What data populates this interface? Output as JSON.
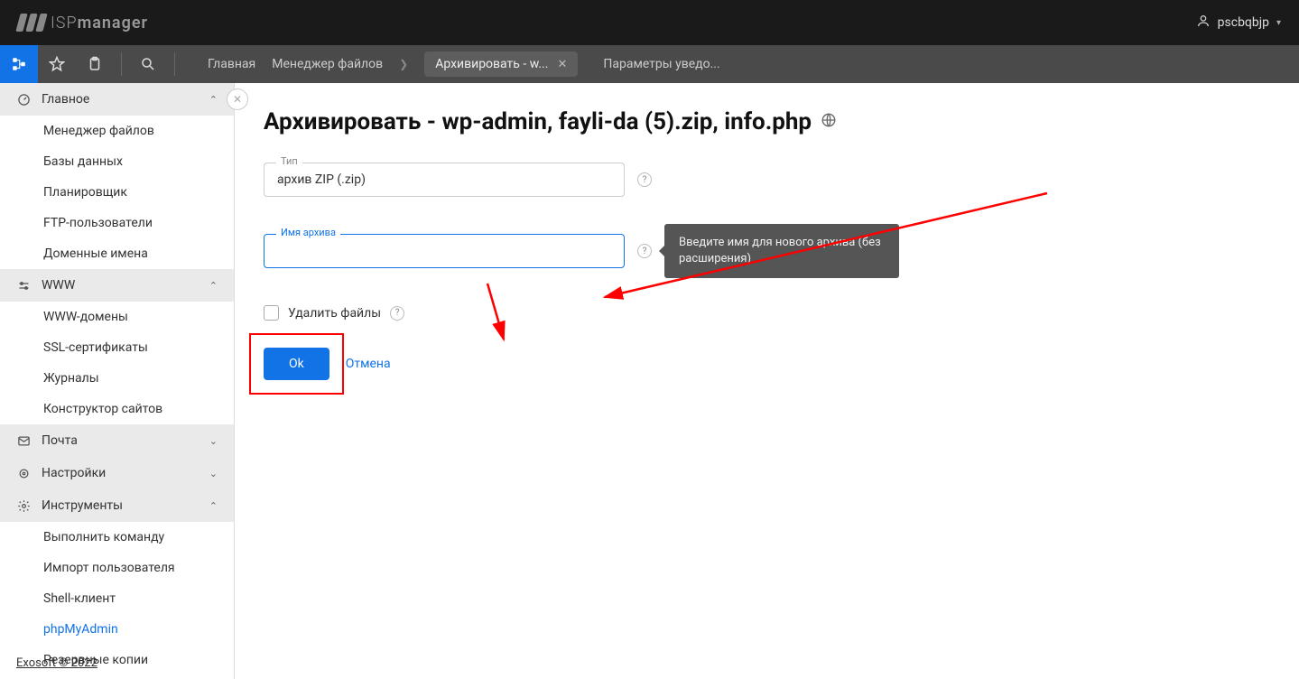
{
  "header": {
    "logo_text": "ISP",
    "logo_text2": "manager",
    "user": "pscbqbjp"
  },
  "subheader": {
    "breadcrumb_home": "Главная",
    "breadcrumb_fm": "Менеджер файлов",
    "tab_label": "Архивировать - w...",
    "extra": "Параметры уведо..."
  },
  "sidebar": {
    "groups": [
      {
        "label": "Главное",
        "expanded": true,
        "icon": "gauge",
        "items": [
          "Менеджер файлов",
          "Базы данных",
          "Планировщик",
          "FTP-пользователи",
          "Доменные имена"
        ]
      },
      {
        "label": "WWW",
        "expanded": true,
        "icon": "sliders",
        "items": [
          "WWW-домены",
          "SSL-сертификаты",
          "Журналы",
          "Конструктор сайтов"
        ]
      },
      {
        "label": "Почта",
        "expanded": false,
        "icon": "mail",
        "items": []
      },
      {
        "label": "Настройки",
        "expanded": false,
        "icon": "cog",
        "items": []
      },
      {
        "label": "Инструменты",
        "expanded": true,
        "icon": "gear",
        "items": [
          "Выполнить команду",
          "Импорт пользователя",
          "Shell-клиент",
          "phpMyAdmin",
          "Резервные копии"
        ]
      }
    ],
    "active_item": "phpMyAdmin"
  },
  "page": {
    "title": "Архивировать - wp-admin, fayli-da (5).zip, info.php",
    "type_label": "Тип",
    "type_value": "архив ZIP (.zip)",
    "name_label": "Имя архива",
    "name_value": "",
    "delete_files": "Удалить файлы",
    "ok": "Ok",
    "cancel": "Отмена",
    "tooltip": "Введите имя для нового архива (без расширения)"
  },
  "footer": "Exosoft © 2022"
}
